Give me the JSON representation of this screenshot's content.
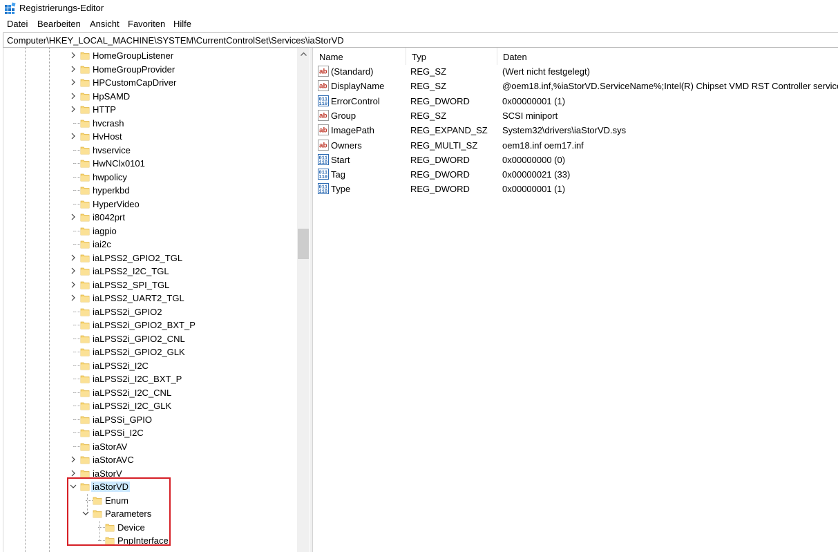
{
  "window": {
    "title": "Registrierungs-Editor"
  },
  "menu": [
    "Datei",
    "Bearbeiten",
    "Ansicht",
    "Favoriten",
    "Hilfe"
  ],
  "address": "Computer\\HKEY_LOCAL_MACHINE\\SYSTEM\\CurrentControlSet\\Services\\iaStorVD",
  "tree": [
    {
      "label": "HomeGroupListener",
      "expandable": true
    },
    {
      "label": "HomeGroupProvider",
      "expandable": true
    },
    {
      "label": "HPCustomCapDriver",
      "expandable": true
    },
    {
      "label": "HpSAMD",
      "expandable": true
    },
    {
      "label": "HTTP",
      "expandable": true
    },
    {
      "label": "hvcrash",
      "expandable": false
    },
    {
      "label": "HvHost",
      "expandable": true
    },
    {
      "label": "hvservice",
      "expandable": false
    },
    {
      "label": "HwNClx0101",
      "expandable": false
    },
    {
      "label": "hwpolicy",
      "expandable": false
    },
    {
      "label": "hyperkbd",
      "expandable": false
    },
    {
      "label": "HyperVideo",
      "expandable": false
    },
    {
      "label": "i8042prt",
      "expandable": true
    },
    {
      "label": "iagpio",
      "expandable": false
    },
    {
      "label": "iai2c",
      "expandable": false
    },
    {
      "label": "iaLPSS2_GPIO2_TGL",
      "expandable": true
    },
    {
      "label": "iaLPSS2_I2C_TGL",
      "expandable": true
    },
    {
      "label": "iaLPSS2_SPI_TGL",
      "expandable": true
    },
    {
      "label": "iaLPSS2_UART2_TGL",
      "expandable": true
    },
    {
      "label": "iaLPSS2i_GPIO2",
      "expandable": false
    },
    {
      "label": "iaLPSS2i_GPIO2_BXT_P",
      "expandable": false
    },
    {
      "label": "iaLPSS2i_GPIO2_CNL",
      "expandable": false
    },
    {
      "label": "iaLPSS2i_GPIO2_GLK",
      "expandable": false
    },
    {
      "label": "iaLPSS2i_I2C",
      "expandable": false
    },
    {
      "label": "iaLPSS2i_I2C_BXT_P",
      "expandable": false
    },
    {
      "label": "iaLPSS2i_I2C_CNL",
      "expandable": false
    },
    {
      "label": "iaLPSS2i_I2C_GLK",
      "expandable": false
    },
    {
      "label": "iaLPSSi_GPIO",
      "expandable": false
    },
    {
      "label": "iaLPSSi_I2C",
      "expandable": false
    },
    {
      "label": "iaStorAV",
      "expandable": false
    },
    {
      "label": "iaStorAVC",
      "expandable": true
    },
    {
      "label": "iaStorV",
      "expandable": true
    },
    {
      "label": "iaStorVD",
      "expandable": true,
      "expanded": true,
      "selected": true
    },
    {
      "label": "Enum",
      "expandable": false,
      "depth": 1
    },
    {
      "label": "Parameters",
      "expandable": true,
      "expanded": true,
      "depth": 1
    },
    {
      "label": "Device",
      "expandable": false,
      "depth": 2
    },
    {
      "label": "PnpInterface",
      "expandable": false,
      "depth": 2
    }
  ],
  "columns": {
    "name": "Name",
    "type": "Typ",
    "data": "Daten"
  },
  "values": [
    {
      "icon": "string-value-icon",
      "name": "(Standard)",
      "type": "REG_SZ",
      "data": "(Wert nicht festgelegt)"
    },
    {
      "icon": "string-value-icon",
      "name": "DisplayName",
      "type": "REG_SZ",
      "data": "@oem18.inf,%iaStorVD.ServiceName%;Intel(R) Chipset VMD RST Controller service"
    },
    {
      "icon": "binary-value-icon",
      "name": "ErrorControl",
      "type": "REG_DWORD",
      "data": "0x00000001 (1)"
    },
    {
      "icon": "string-value-icon",
      "name": "Group",
      "type": "REG_SZ",
      "data": "SCSI miniport"
    },
    {
      "icon": "string-value-icon",
      "name": "ImagePath",
      "type": "REG_EXPAND_SZ",
      "data": "System32\\drivers\\iaStorVD.sys"
    },
    {
      "icon": "string-value-icon",
      "name": "Owners",
      "type": "REG_MULTI_SZ",
      "data": "oem18.inf oem17.inf"
    },
    {
      "icon": "binary-value-icon",
      "name": "Start",
      "type": "REG_DWORD",
      "data": "0x00000000 (0)"
    },
    {
      "icon": "binary-value-icon",
      "name": "Tag",
      "type": "REG_DWORD",
      "data": "0x00000021 (33)"
    },
    {
      "icon": "binary-value-icon",
      "name": "Type",
      "type": "REG_DWORD",
      "data": "0x00000001 (1)"
    }
  ],
  "colors": {
    "selection": "#cce8ff",
    "highlight": "#d61f26",
    "folder": "#f8d775"
  }
}
